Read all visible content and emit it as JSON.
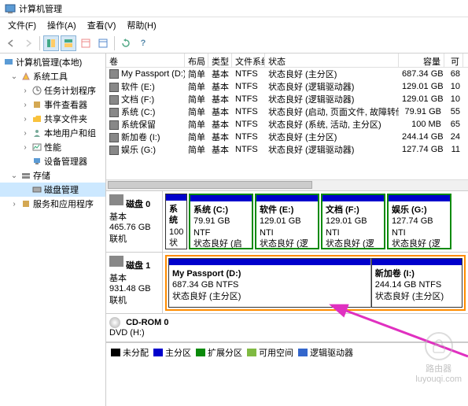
{
  "title": "计算机管理",
  "menu": {
    "file": "文件(F)",
    "action": "操作(A)",
    "view": "查看(V)",
    "help": "帮助(H)"
  },
  "tree": {
    "root": "计算机管理(本地)",
    "sys_tools": "系统工具",
    "task_scheduler": "任务计划程序",
    "event_viewer": "事件查看器",
    "shared_folders": "共享文件夹",
    "local_users": "本地用户和组",
    "performance": "性能",
    "device_mgr": "设备管理器",
    "storage": "存储",
    "disk_mgmt": "磁盘管理",
    "services": "服务和应用程序"
  },
  "cols": {
    "vol": "卷",
    "layout": "布局",
    "type": "类型",
    "fs": "文件系统",
    "status": "状态",
    "capacity": "容量",
    "free": "可"
  },
  "volumes": [
    {
      "name": "My Passport (D:)",
      "layout": "简单",
      "type": "基本",
      "fs": "NTFS",
      "status": "状态良好 (主分区)",
      "cap": "687.34 GB",
      "free": "68"
    },
    {
      "name": "软件 (E:)",
      "layout": "简单",
      "type": "基本",
      "fs": "NTFS",
      "status": "状态良好 (逻辑驱动器)",
      "cap": "129.01 GB",
      "free": "10"
    },
    {
      "name": "文档 (F:)",
      "layout": "简单",
      "type": "基本",
      "fs": "NTFS",
      "status": "状态良好 (逻辑驱动器)",
      "cap": "129.01 GB",
      "free": "10"
    },
    {
      "name": "系统 (C:)",
      "layout": "简单",
      "type": "基本",
      "fs": "NTFS",
      "status": "状态良好 (启动, 页面文件, 故障转储, 主分区)",
      "cap": "79.91 GB",
      "free": "55"
    },
    {
      "name": "系统保留",
      "layout": "简单",
      "type": "基本",
      "fs": "NTFS",
      "status": "状态良好 (系统, 活动, 主分区)",
      "cap": "100 MB",
      "free": "65"
    },
    {
      "name": "新加卷 (I:)",
      "layout": "简单",
      "type": "基本",
      "fs": "NTFS",
      "status": "状态良好 (主分区)",
      "cap": "244.14 GB",
      "free": "24"
    },
    {
      "name": "娱乐 (G:)",
      "layout": "简单",
      "type": "基本",
      "fs": "NTFS",
      "status": "状态良好 (逻辑驱动器)",
      "cap": "127.74 GB",
      "free": "11"
    }
  ],
  "disk0": {
    "title": "磁盘 0",
    "type": "基本",
    "size": "465.76 GB",
    "status": "联机",
    "parts": [
      {
        "name": "系统",
        "size": "100",
        "status": "状态"
      },
      {
        "name": "系统 (C:)",
        "size": "79.91 GB NTF",
        "status": "状态良好 (启动"
      },
      {
        "name": "软件 (E:)",
        "size": "129.01 GB NTI",
        "status": "状态良好 (逻辑"
      },
      {
        "name": "文档 (F:)",
        "size": "129.01 GB NTI",
        "status": "状态良好 (逻辑"
      },
      {
        "name": "娱乐 (G:)",
        "size": "127.74 GB NTI",
        "status": "状态良好 (逻辑"
      }
    ]
  },
  "disk1": {
    "title": "磁盘 1",
    "type": "基本",
    "size": "931.48 GB",
    "status": "联机",
    "parts": [
      {
        "name": "My Passport  (D:)",
        "size": "687.34 GB NTFS",
        "status": "状态良好 (主分区)"
      },
      {
        "name": "新加卷   (I:)",
        "size": "244.14 GB NTFS",
        "status": "状态良好 (主分区)"
      }
    ]
  },
  "cdrom": {
    "title": "CD-ROM 0",
    "type": "DVD (H:)"
  },
  "legend": {
    "unalloc": "未分配",
    "primary": "主分区",
    "extended": "扩展分区",
    "free": "可用空间",
    "logical": "逻辑驱动器"
  },
  "watermark": "路由器\nluyouqi.com"
}
